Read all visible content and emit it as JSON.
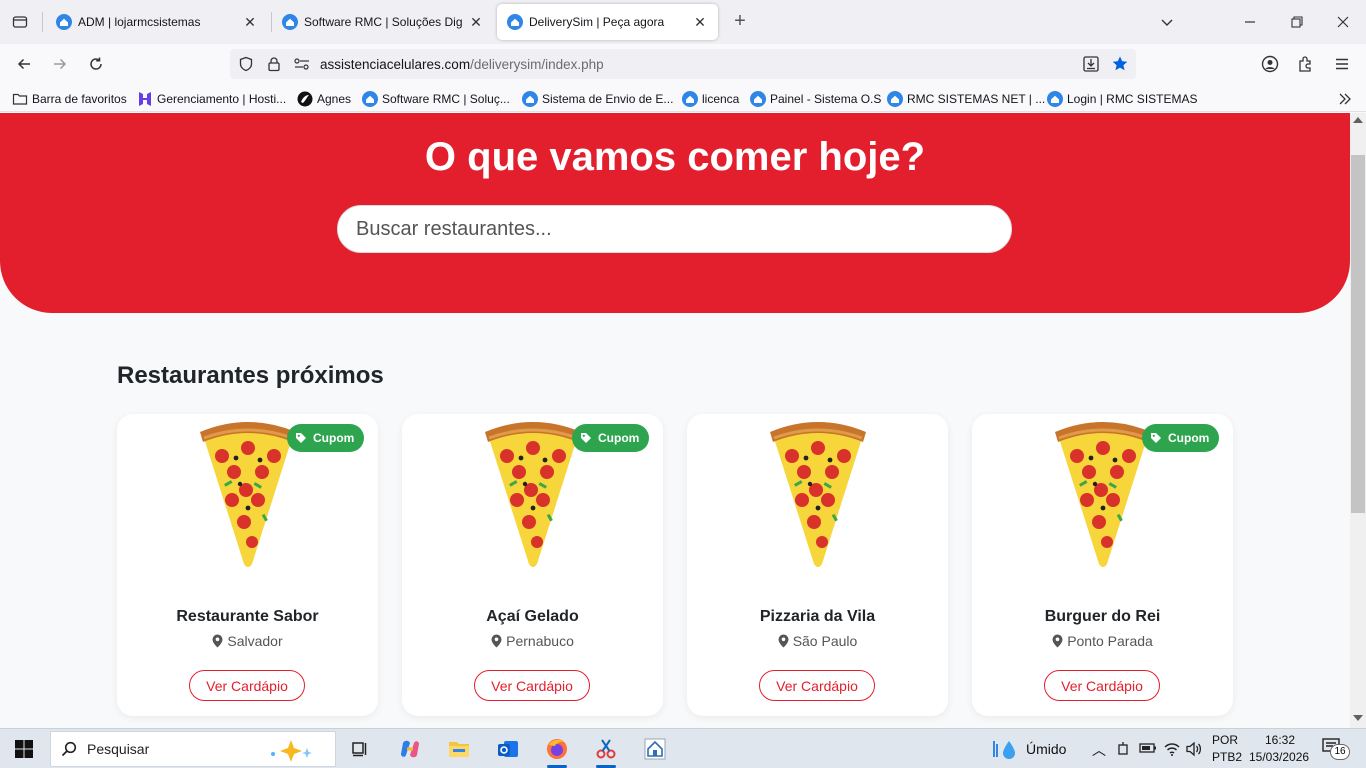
{
  "browser": {
    "tabs": [
      {
        "title": "ADM | lojarmcsistemas",
        "active": false
      },
      {
        "title": "Software RMC | Soluções Digitais",
        "active": false
      },
      {
        "title": "DeliverySim | Peça agora",
        "active": true
      }
    ],
    "url_host": "assistenciacelulares.com",
    "url_path": "/deliverysim/index.php",
    "bookmarks": [
      {
        "label": "Barra de favoritos",
        "icon": "folder-icon"
      },
      {
        "label": "Gerenciamento | Hosti...",
        "icon": "hostinger-icon"
      },
      {
        "label": "Agnes",
        "icon": "agnes-icon"
      },
      {
        "label": "Software RMC | Soluç...",
        "icon": "house-icon"
      },
      {
        "label": "Sistema de Envio de E...",
        "icon": "house-icon"
      },
      {
        "label": "licenca",
        "icon": "house-icon"
      },
      {
        "label": "Painel - Sistema O.S",
        "icon": "house-icon"
      },
      {
        "label": "RMC SISTEMAS NET | ...",
        "icon": "house-icon"
      },
      {
        "label": "Login | RMC SISTEMAS",
        "icon": "house-icon"
      }
    ]
  },
  "hero": {
    "title": "O que vamos comer hoje?",
    "search_placeholder": "Buscar restaurantes..."
  },
  "section": {
    "title": "Restaurantes próximos"
  },
  "restaurants": [
    {
      "name": "Restaurante Sabor",
      "location": "Salvador",
      "badge": "Cupom",
      "has_badge": true,
      "button": "Ver Cardápio"
    },
    {
      "name": "Açaí Gelado",
      "location": "Pernabuco",
      "badge": "Cupom",
      "has_badge": true,
      "button": "Ver Cardápio"
    },
    {
      "name": "Pizzaria da Vila",
      "location": "São Paulo",
      "badge": "",
      "has_badge": false,
      "button": "Ver Cardápio"
    },
    {
      "name": "Burguer do Rei",
      "location": "Ponto Parada",
      "badge": "Cupom",
      "has_badge": true,
      "button": "Ver Cardápio"
    }
  ],
  "taskbar": {
    "search_label": "Pesquisar",
    "weather": "Úmido",
    "lang_1": "POR",
    "lang_2": "PTB2",
    "time": "16:32",
    "date": "15/03/2026",
    "notifications": "16"
  },
  "colors": {
    "brand_red": "#e31e2d",
    "badge_green": "#2ea44f"
  }
}
